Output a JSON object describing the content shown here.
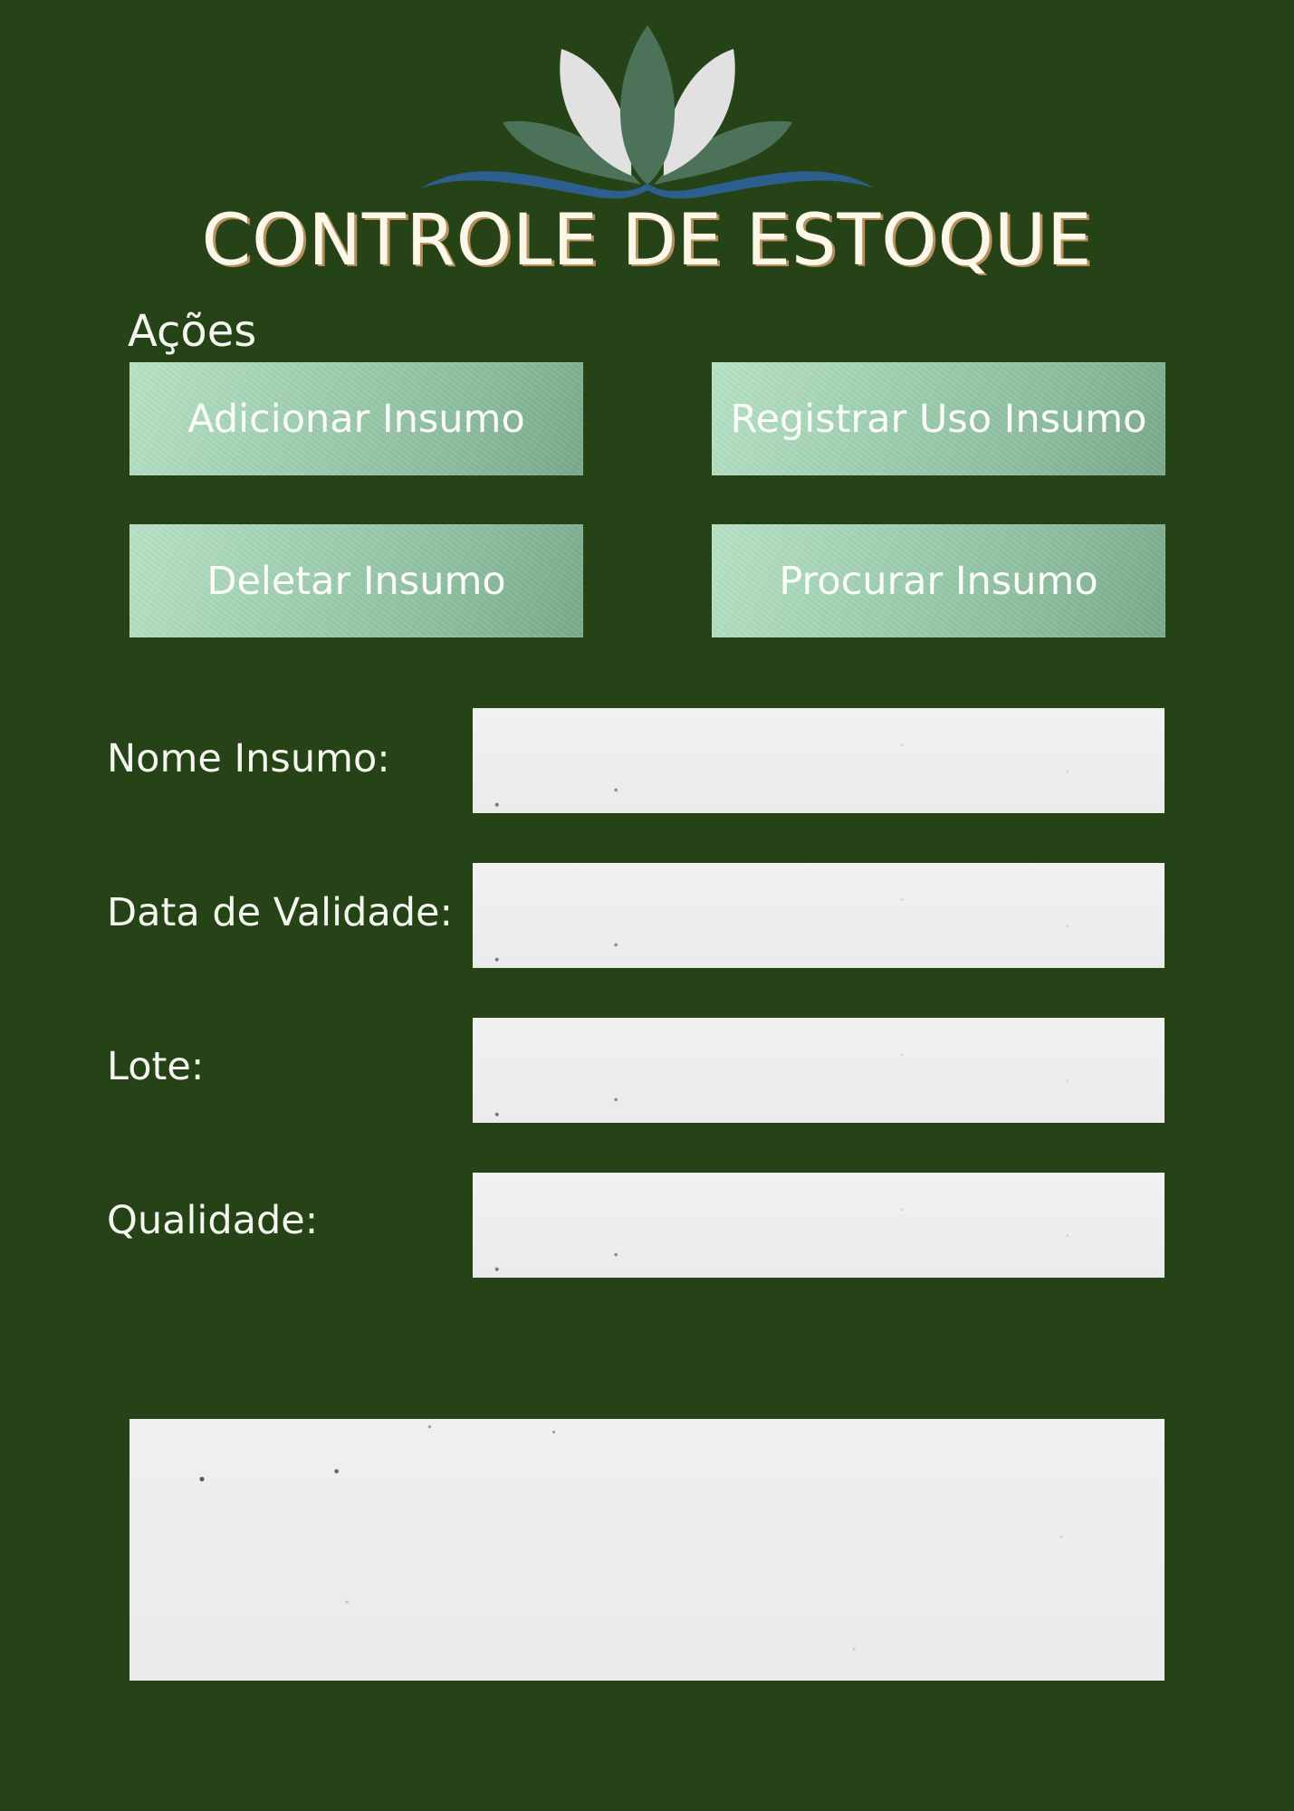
{
  "header": {
    "title": "CONTROLE DE ESTOQUE",
    "logo_icon": "lotus-icon"
  },
  "actions": {
    "section_title": "Ações",
    "add_label": "Adicionar Insumo",
    "register_use_label": "Registrar Uso Insumo",
    "delete_label": "Deletar Insumo",
    "search_label": "Procurar Insumo"
  },
  "form": {
    "name": {
      "label": "Nome Insumo:",
      "value": ""
    },
    "expiry": {
      "label": "Data de Validade:",
      "value": ""
    },
    "lot": {
      "label": "Lote:",
      "value": ""
    },
    "quality": {
      "label": "Qualidade:",
      "value": ""
    }
  },
  "output": {
    "text": ""
  },
  "colors": {
    "background": "#264317",
    "button": "#a2d1b2",
    "field": "#efefef",
    "title_text": "#fbf8ea",
    "title_shadow": "#b88f5b",
    "wave": "#2d5f8e",
    "leaf_dark": "#4c735a",
    "leaf_light": "#e1e1e1"
  }
}
